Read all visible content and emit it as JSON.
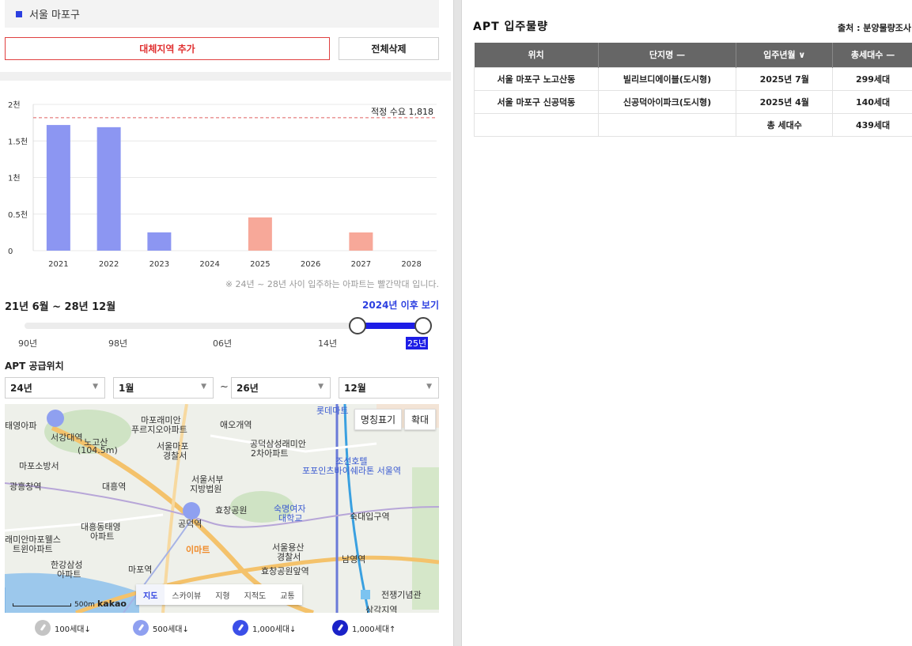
{
  "region": {
    "label": "서울 마포구"
  },
  "buttons": {
    "add": "대체지역 추가",
    "delete_all": "전체삭제"
  },
  "chart_data": {
    "type": "bar",
    "categories": [
      "2021",
      "2022",
      "2023",
      "2024",
      "2025",
      "2026",
      "2027",
      "2028"
    ],
    "values": [
      1718,
      1688,
      250,
      0,
      454,
      0,
      249,
      0
    ],
    "highlight_from": "2024",
    "colors": {
      "past": "#8c96f2",
      "future": "#f7a899"
    },
    "ylim": [
      0,
      2000
    ],
    "yticks": [
      0,
      500,
      1000,
      1500,
      2000
    ],
    "ytick_labels": [
      "0",
      "0.5천",
      "1천",
      "1.5천",
      "2천"
    ],
    "reference_line": {
      "value": 1818,
      "label": "적정 수요 1,818",
      "color": "#e06060"
    },
    "grid": true
  },
  "chart_note": "※ 24년 ~ 28년 사이 입주하는 아파트는 빨간막대 입니다.",
  "period": {
    "label": "21년 6월 ~ 28년 12월",
    "after_link": "2024년 이후 보기"
  },
  "slider": {
    "ticks": [
      "90년",
      "98년",
      "06년",
      "14년",
      "25년"
    ],
    "selected_tick": "25년",
    "range_fraction": [
      0.835,
      1.0
    ]
  },
  "supply": {
    "title": "APT 공급위치",
    "from_year": "24년",
    "from_month": "1월",
    "separator": "~",
    "to_year": "26년",
    "to_month": "12월"
  },
  "map": {
    "buttons": {
      "names": "명칭표기",
      "zoom": "확대"
    },
    "types": [
      "지도",
      "스카이뷰",
      "지형",
      "지적도",
      "교통"
    ],
    "active_type": "지도",
    "scale": "500m",
    "brand": "kakao",
    "labels": {
      "l1": "태영아파",
      "l2": "서강대역",
      "l3": "노고산",
      "l4": "(104.5m)",
      "l5": "마포소방서",
      "l6": "광흥창역",
      "l7": "대흥역",
      "l8": "마포래미안",
      "l9": "푸르지오아파트",
      "l10": "애오개역",
      "l11": "서울마포",
      "l12": "경찰서",
      "l13": "공덕삼성래미안",
      "l14": "2차아파트",
      "l15": "롯데마트",
      "l16": "조선호텔",
      "l17": "포포인츠바이쉐라톤 서울역",
      "l18": "서울서부",
      "l19": "지방법원",
      "l20": "효창공원",
      "l21": "숙명여자",
      "l22": "대학교",
      "l23": "숙대입구역",
      "l24": "공덕역",
      "l25": "대흥동태영",
      "l26": "아파트",
      "l27": "래미안마포웰스",
      "l28": "트윈아파트",
      "l29": "이마트",
      "l30": "서울용산",
      "l31": "경찰서",
      "l32": "한강삼성",
      "l33": "아파트",
      "l34": "마포역",
      "l35": "효창공원앞역",
      "l36": "남영역",
      "l37": "전쟁기념관",
      "l38": "삼각지역"
    }
  },
  "pin_legend": [
    {
      "label": "100세대↓",
      "color": "#c4c4c4"
    },
    {
      "label": "500세대↓",
      "color": "#8fa0f0"
    },
    {
      "label": "1,000세대↓",
      "color": "#3b4fe8"
    },
    {
      "label": "1,000세대↑",
      "color": "#1a22c8"
    }
  ],
  "apt": {
    "title": "APT 입주물량",
    "source": "출처 : 분양물량조사",
    "headers": [
      "위치",
      "단지명 —",
      "입주년월 ∨",
      "총세대수 —"
    ],
    "rows": [
      [
        "서울 마포구 노고산동",
        "빌리브디에이블(도시형)",
        "2025년 7월",
        "299세대"
      ],
      [
        "서울 마포구 신공덕동",
        "신공덕아이파크(도시형)",
        "2025년 4월",
        "140세대"
      ]
    ],
    "total": {
      "label": "총 세대수",
      "value": "439세대"
    }
  }
}
